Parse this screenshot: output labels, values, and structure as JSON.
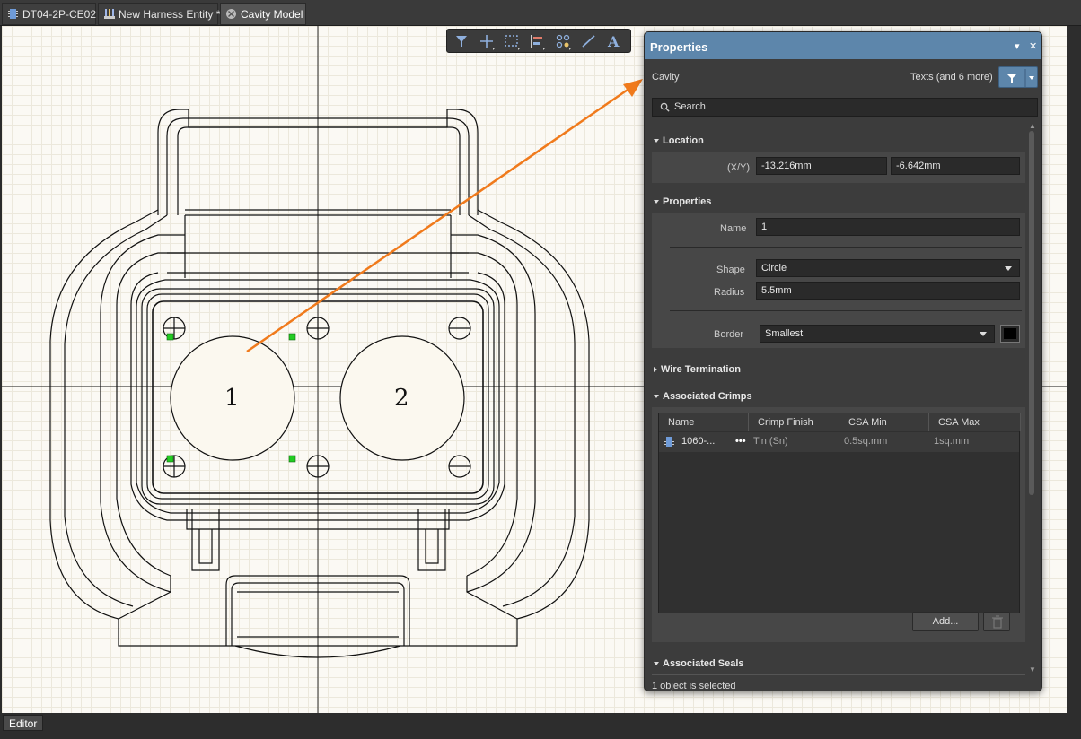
{
  "tabs": [
    {
      "label": "DT04-2P-CE02 *"
    },
    {
      "label": "New Harness Entity *"
    },
    {
      "label": "Cavity Model"
    }
  ],
  "status": {
    "editor_tab": "Editor"
  },
  "toolbar": {
    "icons": [
      "filter-icon",
      "crosshair-icon",
      "select-rect-icon",
      "align-icon",
      "cavity-place-icon",
      "line-icon",
      "text-icon"
    ]
  },
  "canvas": {
    "cavity_labels": [
      "1",
      "2"
    ]
  },
  "panel": {
    "title": "Properties",
    "object_type": "Cavity",
    "filter_summary": "Texts (and 6 more)",
    "search_placeholder": "Search",
    "location": {
      "header": "Location",
      "xy_label": "(X/Y)",
      "x": "-13.216mm",
      "y": "-6.642mm"
    },
    "properties": {
      "header": "Properties",
      "name_label": "Name",
      "name_value": "1",
      "shape_label": "Shape",
      "shape_value": "Circle",
      "radius_label": "Radius",
      "radius_value": "5.5mm",
      "border_label": "Border",
      "border_value": "Smallest",
      "border_color": "#000000"
    },
    "wire_termination": {
      "header": "Wire Termination"
    },
    "associated_crimps": {
      "header": "Associated Crimps",
      "columns": [
        "Name",
        "Crimp Finish",
        "CSA Min",
        "CSA Max"
      ],
      "rows": [
        {
          "name": "1060-...",
          "finish": "Tin (Sn)",
          "csa_min": "0.5sq.mm",
          "csa_max": "1sq.mm"
        }
      ],
      "add_label": "Add..."
    },
    "associated_seals": {
      "header": "Associated Seals"
    },
    "status": "1 object is selected"
  },
  "colors": {
    "accent": "#5d86ab",
    "arrow": "#f07a1c",
    "grid": "#ece8dc",
    "selection_handle": "#22cc22"
  }
}
